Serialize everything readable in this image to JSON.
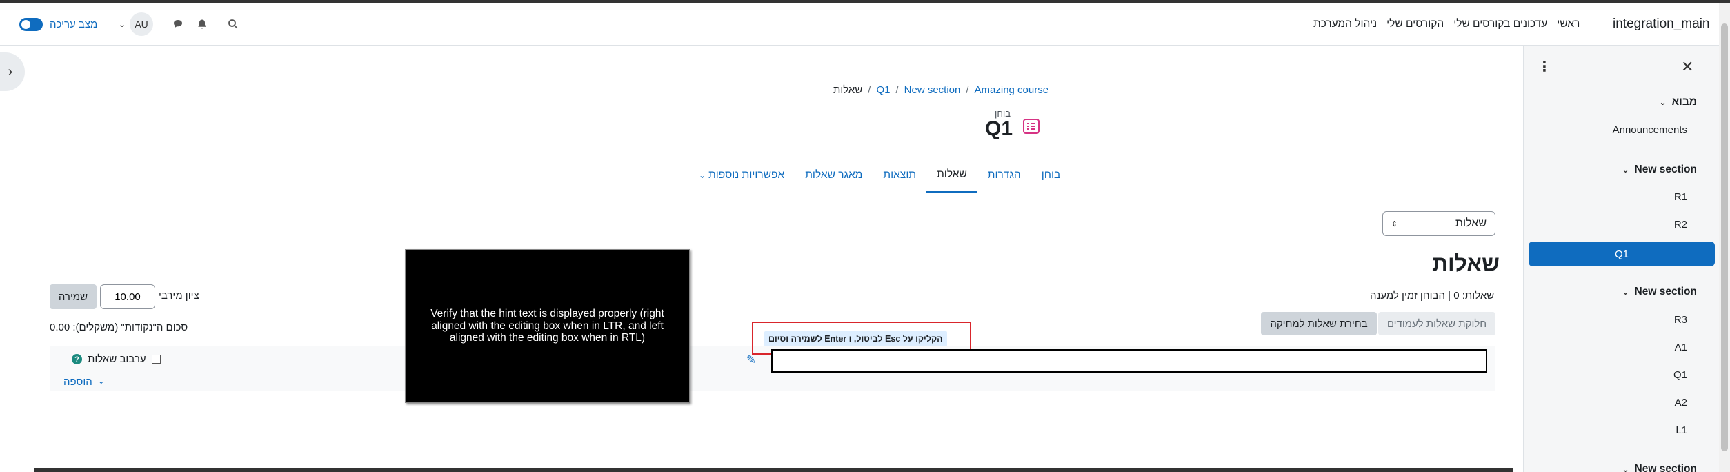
{
  "navbar": {
    "site_name": "integration_main",
    "primary_nav": [
      "ראשי",
      "עדכונים בקורסים שלי",
      "הקורסים שלי",
      "ניהול המערכת"
    ],
    "user_initials": "AU",
    "edit_mode_label": "מצב עריכה",
    "edit_mode_on": true
  },
  "drawer": {
    "sections": [
      {
        "title": "מבוא",
        "items": [
          "Announcements"
        ]
      },
      {
        "title": "New section",
        "items": [
          "R1",
          "R2",
          "Q1"
        ]
      },
      {
        "title": "New section",
        "items": [
          "R3",
          "A1",
          "Q1",
          "A2",
          "L1"
        ]
      },
      {
        "title": "New section",
        "items": []
      }
    ],
    "active_item": "Q1"
  },
  "breadcrumb": [
    "Amazing course",
    "New section",
    "Q1",
    "שאלות"
  ],
  "module": {
    "type_label": "בוחן",
    "title": "Q1"
  },
  "tabs": [
    {
      "label": "בוחן",
      "active": false
    },
    {
      "label": "הגדרות",
      "active": false
    },
    {
      "label": "שאלות",
      "active": true
    },
    {
      "label": "תוצאות",
      "active": false
    },
    {
      "label": "מאגר שאלות",
      "active": false
    },
    {
      "label": "אפשרויות נוספות",
      "active": false
    }
  ],
  "page_select": {
    "value": "שאלות"
  },
  "questions": {
    "heading": "שאלות",
    "info": "שאלות: 0 | הבוחן זמין למענה",
    "repaginate_label": "חלוקת שאלות לעמודים",
    "select_multiple_label": "בחירת שאלות למחיקה",
    "max_grade_label": "ציון מירבי",
    "max_grade_value": "10.00",
    "save_label": "שמירה",
    "total_marks": "סכום ה\"נקודות\" (משקלים): 0.00",
    "shuffle_label": "ערבוב שאלות",
    "add_label": "הוספה"
  },
  "inplace_edit": {
    "hint": "הקליקו על Esc לביטול, ו Enter לשמירה וסיום",
    "value": ""
  },
  "note": "Verify that the hint text is displayed properly (right aligned with the editing box when in LTR, and left aligned with the editing box when in RTL)",
  "colors": {
    "accent": "#0f6cbf",
    "highlight": "#d9262c",
    "quiz_icon": "#d63384"
  }
}
